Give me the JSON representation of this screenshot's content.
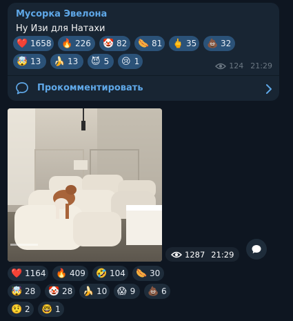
{
  "post1": {
    "channel_name": "Мусорка Эвелона",
    "text": "Ну Изи для Натахи",
    "views": "124",
    "time": "21:29",
    "comment_label": "Прокомментировать",
    "reactions": [
      {
        "emoji": "❤️",
        "count": "1658"
      },
      {
        "emoji": "🔥",
        "count": "226"
      },
      {
        "emoji": "🤡",
        "count": "82"
      },
      {
        "emoji": "🌭",
        "count": "81"
      },
      {
        "emoji": "🖕",
        "count": "35"
      },
      {
        "emoji": "💩",
        "count": "32"
      },
      {
        "emoji": "🤯",
        "count": "13"
      },
      {
        "emoji": "🍌",
        "count": "13"
      },
      {
        "emoji": "😈",
        "count": "5"
      },
      {
        "emoji": "😢",
        "count": "1"
      }
    ]
  },
  "post2": {
    "views": "1287",
    "time": "21:29",
    "reactions": [
      {
        "emoji": "❤️",
        "count": "1164"
      },
      {
        "emoji": "🔥",
        "count": "409"
      },
      {
        "emoji": "🤣",
        "count": "104"
      },
      {
        "emoji": "🌭",
        "count": "30"
      },
      {
        "emoji": "🤯",
        "count": "28"
      },
      {
        "emoji": "🤡",
        "count": "28"
      },
      {
        "emoji": "🍌",
        "count": "10"
      },
      {
        "emoji": "😱",
        "count": "9"
      },
      {
        "emoji": "💩",
        "count": "6"
      },
      {
        "emoji": "🤨",
        "count": "2"
      },
      {
        "emoji": "🤓",
        "count": "1"
      }
    ]
  },
  "colors": {
    "background": "#0e1621",
    "bubble": "#182533",
    "accent": "#5fa8e8",
    "reaction_chip": "#2b5278",
    "muted": "#6c7883"
  },
  "icons": [
    "eye-icon",
    "comment-icon",
    "chevron-right-icon",
    "share-icon"
  ]
}
